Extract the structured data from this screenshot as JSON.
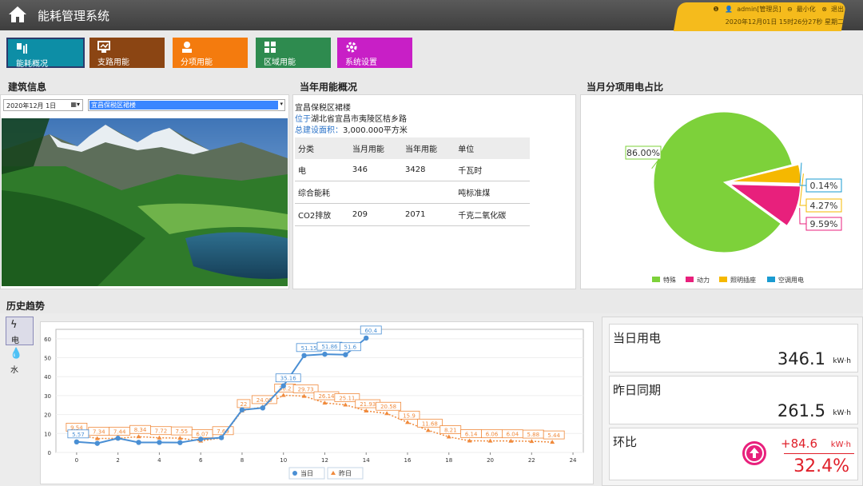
{
  "app": {
    "title": "能耗管理系统"
  },
  "user": {
    "name": "admin[管理员]",
    "minimize": "最小化",
    "logout": "退出",
    "datetime": "2020年12月01日 15时26分27秒 星期二"
  },
  "nav": [
    {
      "label": "能耗概况",
      "color": "#0d8ea6",
      "icon": "energy-overview-icon"
    },
    {
      "label": "支路用能",
      "color": "#8b4513",
      "icon": "branch-icon"
    },
    {
      "label": "分项用能",
      "color": "#f47b0e",
      "icon": "user-icon"
    },
    {
      "label": "区域用能",
      "color": "#2e8b4f",
      "icon": "grid-icon"
    },
    {
      "label": "系统设置",
      "color": "#c81fc6",
      "icon": "gear-icon"
    }
  ],
  "building": {
    "heading": "建筑信息",
    "date": "2020年12月  1日",
    "selected": "宜昌保税区裙楼"
  },
  "annual": {
    "heading": "当年用能概况",
    "name": "宜昌保税区裙楼",
    "loc_prefix": "位于",
    "location": "湖北省宜昌市夷陵区桔乡路",
    "area_label": "总建设面积：",
    "area": "3,000.000平方米",
    "headers": [
      "分类",
      "当月用能",
      "当年用能",
      "单位"
    ],
    "rows": [
      [
        "电",
        "346",
        "3428",
        "千瓦时"
      ],
      [
        "综合能耗",
        "",
        "",
        "吨标准煤"
      ],
      [
        "CO2排放",
        "209",
        "2071",
        "千克二氧化碳"
      ]
    ]
  },
  "pie": {
    "heading": "当月分项用电占比",
    "chart_data": {
      "type": "pie",
      "slices": [
        {
          "name": "特殊",
          "value": 86.0,
          "label": "86.00%",
          "color": "#7dd13a"
        },
        {
          "name": "动力",
          "value": 9.59,
          "label": "9.59%",
          "color": "#e8207c"
        },
        {
          "name": "照明插座",
          "value": 4.27,
          "label": "4.27%",
          "color": "#f5b800"
        },
        {
          "name": "空调用电",
          "value": 0.14,
          "label": "0.14%",
          "color": "#1a9bd1"
        }
      ]
    }
  },
  "history": {
    "heading": "历史趋势",
    "tabs": [
      {
        "label": "电",
        "icon": "lightning-icon"
      },
      {
        "label": "水",
        "icon": "water-drop-icon"
      }
    ],
    "chart_data": {
      "type": "line",
      "x_ticks": [
        0,
        2,
        4,
        6,
        8,
        10,
        12,
        14,
        16,
        18,
        20,
        22,
        24
      ],
      "y_ticks": [
        0,
        10,
        20,
        30,
        40,
        50,
        60
      ],
      "xlim": [
        -1,
        24.5
      ],
      "ylim": [
        0,
        65
      ],
      "series": [
        {
          "name": "当日",
          "color": "#4a8fd4",
          "x": [
            0,
            1,
            2,
            3,
            4,
            5,
            6,
            7,
            8,
            9,
            10,
            11,
            12,
            13,
            14
          ],
          "values": [
            5.57,
            4.8,
            7.5,
            5.3,
            5.3,
            5.2,
            7.0,
            7.8,
            22.5,
            23.5,
            35.16,
            51.15,
            51.86,
            51.6,
            60.4
          ],
          "labels": [
            "5.57",
            "",
            "",
            "",
            "",
            "",
            "",
            "",
            "",
            "",
            "35.16",
            "51.15",
            "51.86",
            "51.6",
            "60.4"
          ]
        },
        {
          "name": "昨日",
          "color": "#f08a3c",
          "x": [
            0,
            1,
            2,
            3,
            4,
            5,
            6,
            7,
            8,
            9,
            10,
            11,
            12,
            13,
            14,
            15,
            16,
            17,
            18,
            19,
            20,
            21,
            22,
            23
          ],
          "values": [
            9.54,
            7.34,
            7.44,
            8.34,
            7.72,
            7.55,
            6.07,
            7.69,
            22,
            24.09,
            30.2,
            29.73,
            26.14,
            25.11,
            21.93,
            20.58,
            15.9,
            11.68,
            8.21,
            6.14,
            6.06,
            6.04,
            5.88,
            5.44
          ],
          "labels": [
            "9.54",
            "7.34",
            "7.44",
            "8.34",
            "7.72",
            "7.55",
            "6.07",
            "7.69",
            "22",
            "24.09",
            "30.2",
            "29.73",
            "26.14",
            "25.11",
            "21.93",
            "20.58",
            "15.9",
            "11.68",
            "8.21",
            "6.14",
            "6.06",
            "6.04",
            "5.88",
            "5.44"
          ]
        }
      ]
    }
  },
  "stats": {
    "today": {
      "label": "当日用电",
      "value": "346.1",
      "unit": "kW·h"
    },
    "yesterday": {
      "label": "昨日同期",
      "value": "261.5",
      "unit": "kW·h"
    },
    "ratio": {
      "label": "环比",
      "delta": "+84.6",
      "unit": "kW·h",
      "percent": "32.4%",
      "color": "#e0202a"
    }
  }
}
